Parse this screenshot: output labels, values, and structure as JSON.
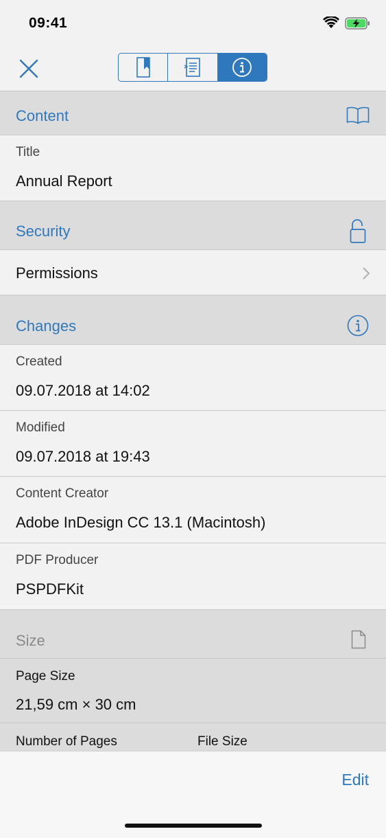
{
  "status_bar": {
    "time": "09:41"
  },
  "nav": {
    "segments": [
      {
        "name": "bookmarks",
        "active": false
      },
      {
        "name": "outline",
        "active": false
      },
      {
        "name": "document-info",
        "active": true
      }
    ]
  },
  "sections": {
    "content": {
      "label": "Content"
    },
    "security": {
      "label": "Security"
    },
    "changes": {
      "label": "Changes"
    },
    "size": {
      "label": "Size"
    }
  },
  "fields": {
    "title": {
      "caption": "Title",
      "value": "Annual Report"
    },
    "permissions": {
      "label": "Permissions"
    },
    "created": {
      "caption": "Created",
      "value": "09.07.2018 at 14:02"
    },
    "modified": {
      "caption": "Modified",
      "value": "09.07.2018 at 19:43"
    },
    "content_creator": {
      "caption": "Content Creator",
      "value": "Adobe InDesign CC 13.1 (Macintosh)"
    },
    "pdf_producer": {
      "caption": "PDF Producer",
      "value": "PSPDFKit"
    },
    "page_size": {
      "caption": "Page Size",
      "value": "21,59 cm × 30 cm"
    },
    "number_of_pages": {
      "caption": "Number of Pages"
    },
    "file_size": {
      "caption": "File Size"
    }
  },
  "toolbar": {
    "edit_label": "Edit"
  },
  "colors": {
    "accent": "#2f78bd",
    "header_bg": "#dcdcdc",
    "background": "#f2f2f2"
  }
}
